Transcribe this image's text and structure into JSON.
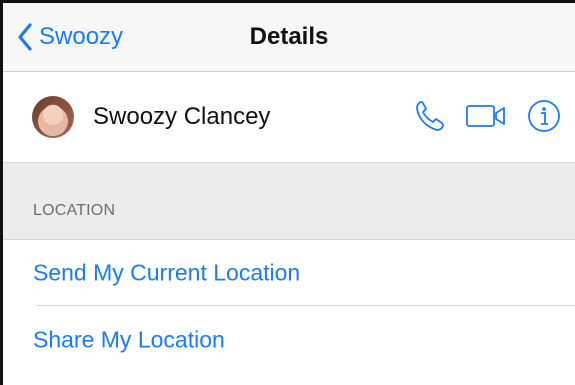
{
  "nav": {
    "back_label": "Swoozy",
    "title": "Details"
  },
  "contact": {
    "name": "Swoozy Clancey",
    "actions": [
      "phone-icon",
      "video-icon",
      "info-icon"
    ]
  },
  "location_section": {
    "header": "LOCATION",
    "items": [
      "Send My Current Location",
      "Share My Location"
    ]
  },
  "colors": {
    "accent": "#1a7cf5",
    "section_bg": "#ececec",
    "navbar_bg": "#f7f7f7"
  }
}
